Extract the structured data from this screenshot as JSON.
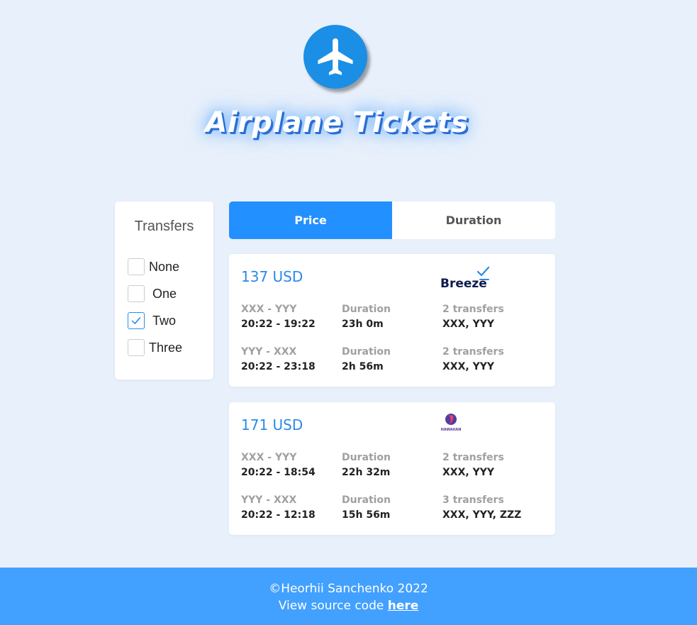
{
  "header": {
    "title": "Airplane Tickets",
    "logo_icon": "airplane-icon"
  },
  "filter": {
    "title": "Transfers",
    "options": [
      {
        "label": "None",
        "checked": false
      },
      {
        "label": "One",
        "checked": false
      },
      {
        "label": "Two",
        "checked": true
      },
      {
        "label": "Three",
        "checked": false
      }
    ]
  },
  "tabs": [
    {
      "label": "Price",
      "active": true
    },
    {
      "label": "Duration",
      "active": false
    }
  ],
  "tickets": [
    {
      "price": "137 USD",
      "carrier": "Breeze",
      "segments": [
        {
          "route": "XXX - YYY",
          "time": "20:22 - 19:22",
          "duration_label": "Duration",
          "duration": "23h 0m",
          "stops_label": "2 transfers",
          "stops": "XXX, YYY"
        },
        {
          "route": "YYY - XXX",
          "time": "20:22 - 23:18",
          "duration_label": "Duration",
          "duration": "2h 56m",
          "stops_label": "2 transfers",
          "stops": "XXX, YYY"
        }
      ]
    },
    {
      "price": "171 USD",
      "carrier": "HAWAIIAN",
      "segments": [
        {
          "route": "XXX - YYY",
          "time": "20:22 - 18:54",
          "duration_label": "Duration",
          "duration": "22h 32m",
          "stops_label": "2 transfers",
          "stops": "XXX, YYY"
        },
        {
          "route": "YYY - XXX",
          "time": "20:22 - 12:18",
          "duration_label": "Duration",
          "duration": "15h 56m",
          "stops_label": "3 transfers",
          "stops": "XXX, YYY, ZZZ"
        }
      ]
    }
  ],
  "footer": {
    "copyright": "©Heorhii Sanchenko 2022",
    "source_text": "View source code",
    "source_link": "here"
  },
  "colors": {
    "accent": "#2390ff",
    "price": "#2a8ae8",
    "footer_bg": "#42a0ff",
    "page_bg": "#e8f0fb"
  }
}
